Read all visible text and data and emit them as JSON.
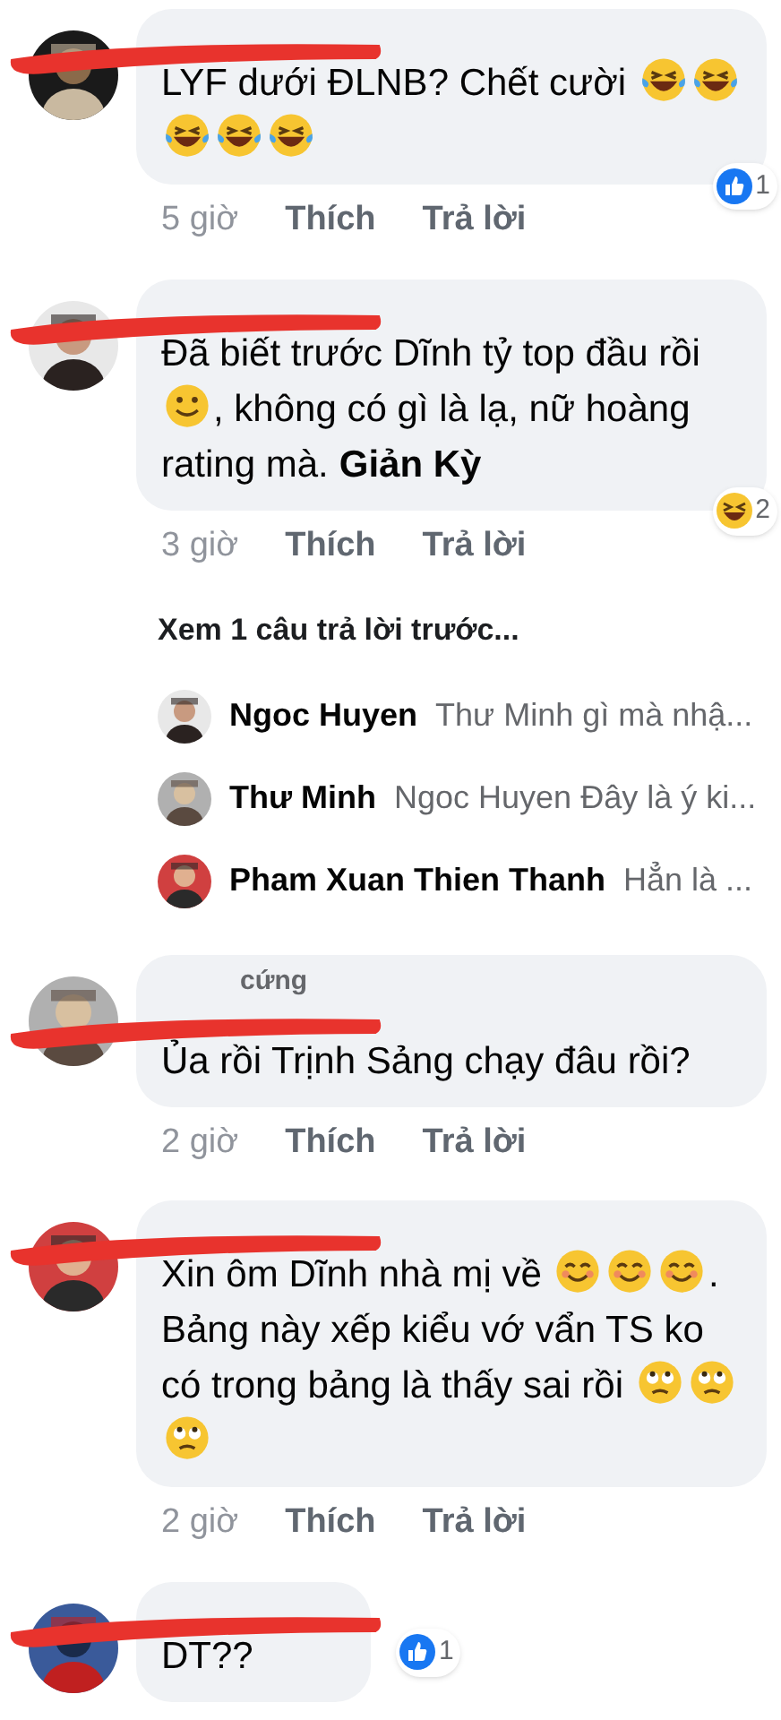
{
  "comments": [
    {
      "body": [
        {
          "kind": "text",
          "text": "LYF dưới ĐLNB? Chết cười"
        },
        {
          "kind": "laugh-cry"
        },
        {
          "kind": "laugh-cry"
        },
        {
          "kind": "laugh-cry"
        },
        {
          "kind": "laugh-cry"
        },
        {
          "kind": "laugh-cry"
        }
      ],
      "time": "5 giờ",
      "like": "Thích",
      "reply": "Trả lời",
      "reaction": {
        "kind": "like",
        "count": "1"
      }
    },
    {
      "body": [
        {
          "kind": "text",
          "text": "Đã biết trước Dĩnh tỷ top đầu rồi"
        },
        {
          "kind": "smile"
        },
        {
          "kind": "text",
          "text": ", không có gì là lạ, nữ hoàng"
        },
        {
          "kind": "text",
          "text": "rating mà."
        },
        {
          "kind": "bold",
          "text": "Giản Kỳ"
        }
      ],
      "time": "3 giờ",
      "like": "Thích",
      "reply": "Trả lời",
      "reaction": {
        "kind": "haha",
        "count": "2"
      },
      "replies": {
        "more": "Xem 1 câu trả lời trước...",
        "items": [
          {
            "name": "Ngoc Huyen",
            "preview": "Thư Minh gì mà nhậ..."
          },
          {
            "name": "Thư Minh",
            "preview": "Ngoc Huyen  Đây là ý ki..."
          },
          {
            "name": "Pham Xuan Thien Thanh",
            "preview": "Hẳn là ..."
          }
        ]
      }
    },
    {
      "badge": "cứng",
      "body": [
        {
          "kind": "text",
          "text": "Ủa rồi Trịnh Sảng chạy đâu rồi?"
        }
      ],
      "time": "2 giờ",
      "like": "Thích",
      "reply": "Trả lời"
    },
    {
      "body": [
        {
          "kind": "text",
          "text": "Xin ôm Dĩnh nhà mị về"
        },
        {
          "kind": "blush"
        },
        {
          "kind": "blush"
        },
        {
          "kind": "blush"
        },
        {
          "kind": "text",
          "text": "."
        },
        {
          "kind": "text",
          "text": "Bảng này xếp kiểu vớ vẩn TS ko"
        },
        {
          "kind": "text",
          "text": "có trong bảng là thấy sai rồi"
        },
        {
          "kind": "eye-roll"
        },
        {
          "kind": "eye-roll"
        },
        {
          "kind": "eye-roll"
        }
      ],
      "time": "2 giờ",
      "like": "Thích",
      "reply": "Trả lời"
    },
    {
      "body": [
        {
          "kind": "text",
          "text": "DT??"
        }
      ],
      "reaction": {
        "kind": "like",
        "count": "1"
      }
    }
  ]
}
